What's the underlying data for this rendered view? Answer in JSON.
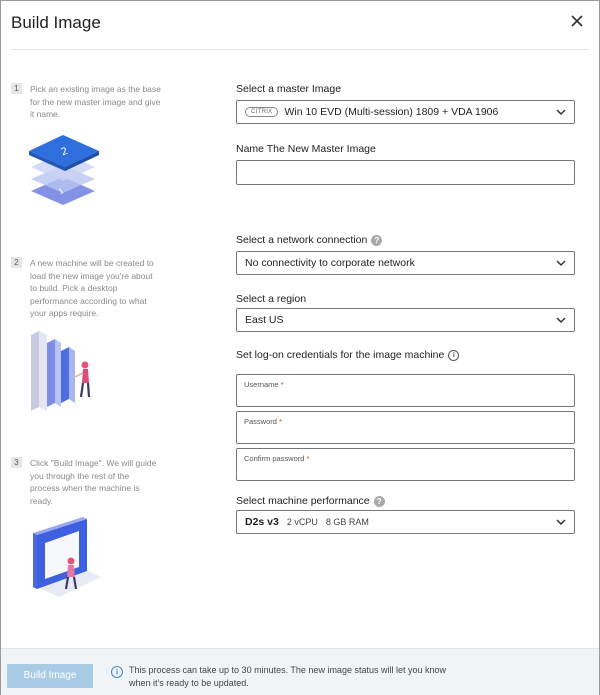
{
  "dialog": {
    "title": "Build Image",
    "close_icon": "close-icon"
  },
  "steps": [
    {
      "number": "1",
      "text": "Pick an existing image as the base for the new master image and give it name."
    },
    {
      "number": "2",
      "text": "A new machine will be created to load the new image you're about to build. Pick a desktop performance according to what your apps require."
    },
    {
      "number": "3",
      "text": "Click \"Build Image\". We will guide you through the rest of the process when the machine is ready."
    }
  ],
  "form": {
    "master_image": {
      "label": "Select a master Image",
      "badge": "CITRIX",
      "value": "Win 10 EVD (Multi-session) 1809 + VDA 1906"
    },
    "new_name": {
      "label": "Name The New Master Image",
      "value": ""
    },
    "network": {
      "label": "Select a network connection",
      "help": "?",
      "value": "No connectivity to corporate network"
    },
    "region": {
      "label": "Select a region",
      "value": "East US"
    },
    "credentials": {
      "label": "Set log-on credentials for the image machine",
      "info": "i",
      "username_label": "Username",
      "password_label": "Password",
      "confirm_label": "Confirm password",
      "required_mark": "*"
    },
    "performance": {
      "label": "Select machine performance",
      "help": "?",
      "size": "D2s v3",
      "cpu": "2 vCPU",
      "ram": "8 GB RAM"
    }
  },
  "footer": {
    "button_label": "Build Image",
    "info": "i",
    "message": "This process can take up to 30 minutes. The new image status will let you know when it's ready to be updated."
  },
  "colors": {
    "accent": "#3d8cc4",
    "button_disabled": "#a8cce6",
    "required": "#e0341f"
  }
}
